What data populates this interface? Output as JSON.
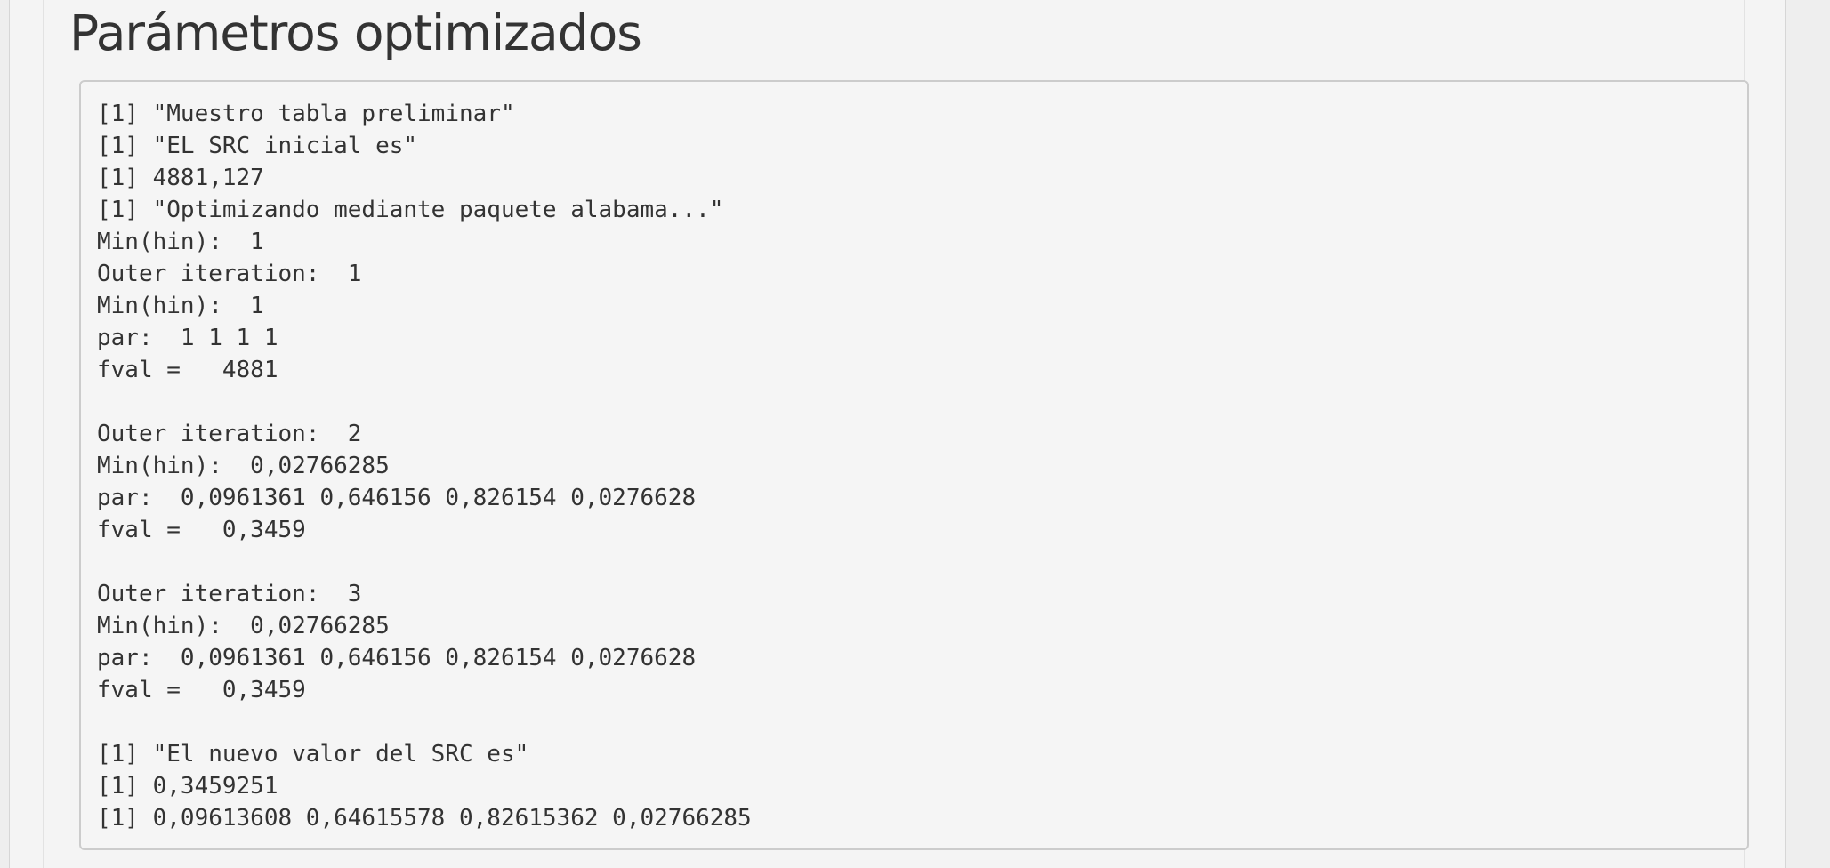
{
  "section": {
    "title": "Parámetros optimizados"
  },
  "console_output": {
    "lines": [
      "[1] \"Muestro tabla preliminar\"",
      "[1] \"EL SRC inicial es\"",
      "[1] 4881,127",
      "[1] \"Optimizando mediante paquete alabama...\"",
      "Min(hin):  1",
      "Outer iteration:  1",
      "Min(hin):  1",
      "par:  1 1 1 1",
      "fval =   4881",
      "",
      "Outer iteration:  2",
      "Min(hin):  0,02766285",
      "par:  0,0961361 0,646156 0,826154 0,0276628",
      "fval =   0,3459",
      "",
      "Outer iteration:  3",
      "Min(hin):  0,02766285",
      "par:  0,0961361 0,646156 0,826154 0,0276628",
      "fval =   0,3459",
      "",
      "[1] \"El nuevo valor del SRC es\"",
      "[1] 0,3459251",
      "[1] 0,09613608 0,64615578 0,82615362 0,02766285"
    ]
  }
}
